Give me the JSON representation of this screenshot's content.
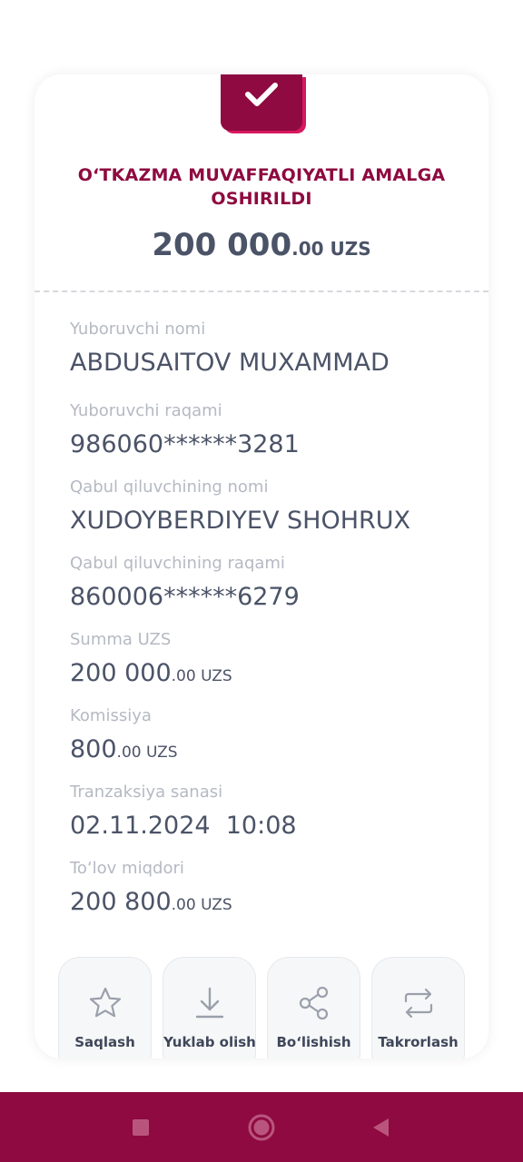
{
  "receipt": {
    "title": "O‘TKAZMA MUVAFFAQIYATLI AMALGA OSHIRILDI",
    "amount_main": "200 000",
    "amount_cents": ".00 UZS"
  },
  "details": {
    "sender_name_label": "Yuboruvchi nomi",
    "sender_name": "ABDUSAITOV MUXAMMAD",
    "sender_number_label": "Yuboruvchi raqami",
    "sender_number": "986060******3281",
    "receiver_name_label": "Qabul qiluvchining nomi",
    "receiver_name": "XUDOYBERDIYEV SHOHRUX",
    "receiver_number_label": "Qabul qiluvchining raqami",
    "receiver_number": "860006******6279",
    "sum_label": "Summa UZS",
    "sum_main": "200 000",
    "sum_cents": ".00 UZS",
    "commission_label": "Komissiya",
    "commission_main": "800",
    "commission_cents": ".00 UZS",
    "date_label": "Tranzaksiya sanasi",
    "date_value": "02.11.2024  10:08",
    "payment_label": "To‘lov miqdori",
    "payment_main": "200 800",
    "payment_cents": ".00 UZS"
  },
  "actions": {
    "save": "Saqlash",
    "download": "Yuklab olish",
    "share": "Bo‘lishish",
    "repeat": "Takrorlash"
  },
  "icons": {
    "status": "check-icon",
    "save": "star-icon",
    "download": "download-icon",
    "share": "share-icon",
    "repeat": "repeat-icon",
    "nav_recent": "square-icon",
    "nav_home": "circle-icon",
    "nav_back": "triangle-back-icon"
  },
  "colors": {
    "brand": "#8e0a40",
    "brand_accent": "#d9175f",
    "text_dark": "#4b5367",
    "text_muted": "#b5b9c2"
  }
}
